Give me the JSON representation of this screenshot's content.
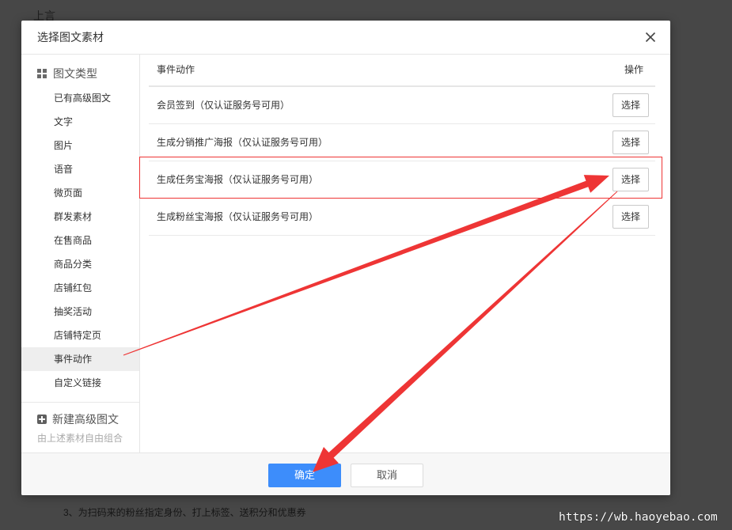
{
  "theme": {
    "accent": "#3d8dfb",
    "annotation": "#ee3535"
  },
  "background_page": {
    "top_label": "上言",
    "bottom_text": "3、为扫码来的粉丝指定身份、打上标签、送积分和优惠券",
    "watermark": "https://wb.haoyebao.com"
  },
  "dialog": {
    "title": "选择图文素材",
    "close_icon": "close-icon",
    "sidebar": {
      "header": {
        "icon": "grid-icon",
        "label": "图文类型"
      },
      "items": [
        {
          "label": "已有高级图文",
          "selected": false
        },
        {
          "label": "文字",
          "selected": false
        },
        {
          "label": "图片",
          "selected": false
        },
        {
          "label": "语音",
          "selected": false
        },
        {
          "label": "微页面",
          "selected": false
        },
        {
          "label": "群发素材",
          "selected": false
        },
        {
          "label": "在售商品",
          "selected": false
        },
        {
          "label": "商品分类",
          "selected": false
        },
        {
          "label": "店铺红包",
          "selected": false
        },
        {
          "label": "抽奖活动",
          "selected": false
        },
        {
          "label": "店铺特定页",
          "selected": false
        },
        {
          "label": "事件动作",
          "selected": true
        },
        {
          "label": "自定义链接",
          "selected": false
        }
      ],
      "create": {
        "icon": "plus-square-icon",
        "label": "新建高级图文",
        "hint": "由上述素材自由组合"
      }
    },
    "table": {
      "columns": [
        "事件动作",
        "操作"
      ],
      "rows": [
        {
          "name": "会员签到（仅认证服务号可用）",
          "action": "选择",
          "highlighted": false
        },
        {
          "name": "生成分销推广海报（仅认证服务号可用）",
          "action": "选择",
          "highlighted": false
        },
        {
          "name": "生成任务宝海报（仅认证服务号可用）",
          "action": "选择",
          "highlighted": true
        },
        {
          "name": "生成粉丝宝海报（仅认证服务号可用）",
          "action": "选择",
          "highlighted": false
        }
      ]
    },
    "footer": {
      "confirm_label": "确定",
      "cancel_label": "取消"
    }
  }
}
